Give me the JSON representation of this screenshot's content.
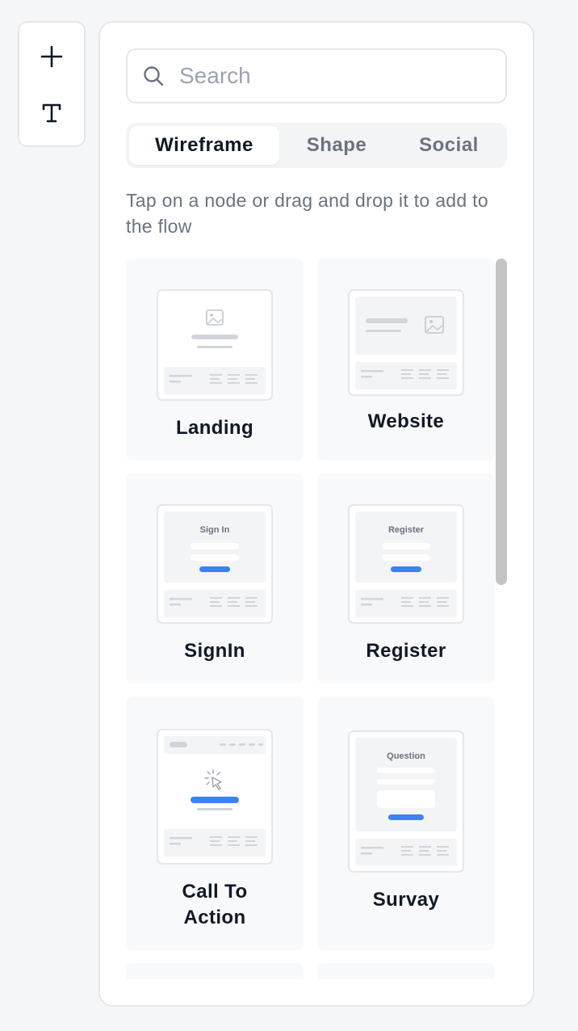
{
  "toolbar": {
    "icons": [
      "plus-icon",
      "text-icon"
    ]
  },
  "search": {
    "placeholder": "Search",
    "value": ""
  },
  "tabs": [
    {
      "label": "Wireframe",
      "active": true
    },
    {
      "label": "Shape",
      "active": false
    },
    {
      "label": "Social",
      "active": false
    }
  ],
  "hint": "Tap on a node or drag and drop it to add to the flow",
  "nodes": [
    {
      "label": "Landing"
    },
    {
      "label": "Website"
    },
    {
      "label": "SignIn",
      "thumb_text": "Sign In"
    },
    {
      "label": "Register",
      "thumb_text": "Register"
    },
    {
      "label": "Call To Action"
    },
    {
      "label": "Survay",
      "thumb_text": "Question"
    }
  ],
  "colors": {
    "accent": "#3b82f6",
    "placeholder_gray": "#d1d5db",
    "thumb_block": "#f3f4f6",
    "border": "#e5e7eb"
  }
}
